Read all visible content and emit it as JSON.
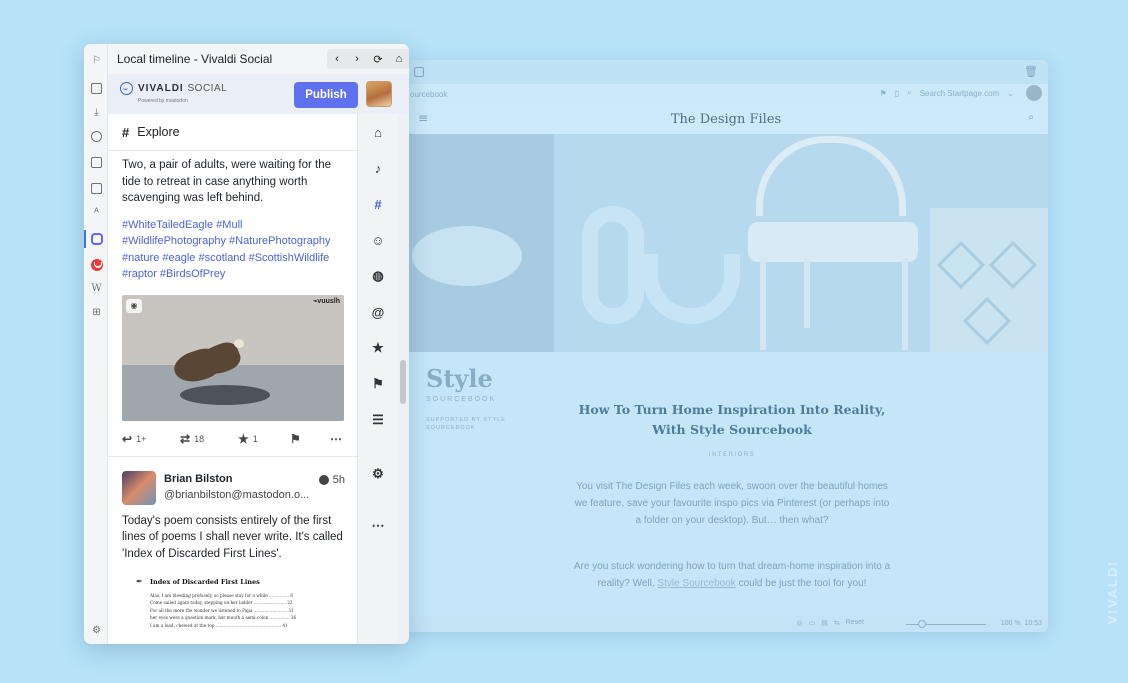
{
  "browser": {
    "panel_title": "Local timeline - Vivaldi Social",
    "nav": {
      "back": "‹",
      "forward": "›",
      "reload": "⟳",
      "home": "⌂",
      "close": "×"
    }
  },
  "mastodon": {
    "brand": "VIVALDI",
    "brand_suffix": "SOCIAL",
    "powered_by": "Powered by mastodon",
    "publish_label": "Publish",
    "column_title": "Explore",
    "post1": {
      "text": "Two, a pair of adults, were waiting for the tide to retreat in case anything worth scavenging was left behind.",
      "hashtags": "#WhiteTailedEagle #Mull #WildlifePhotography #NaturePhotography #nature #eagle #scotland #ScottishWildlife #raptor #BirdsOfPrey",
      "image_watermark": "⌁vuuslh",
      "reply_count": "1+",
      "boost_count": "18",
      "fav_count": "1"
    },
    "post2": {
      "author_name": "Brian Bilston",
      "author_handle": "@brianbilston@mastodon.o...",
      "time": "5h",
      "text": "Today's poem consists entirely of the first lines of poems I shall never write. It's called 'Index of Discarded First Lines'.",
      "poem_title": "Index of Discarded First Lines",
      "poem_lines": [
        "Alas, I am bleeding profusely, so please stay for a while ............... 6",
        "Come sailed again today, stepping on her ladder ........................ 22",
        "For all the more the wonder we listened to Papa ......................... 31",
        "her eyes were a question mark, her mouth a semi-colon ............... 36",
        "I am a lead, chewed at the top ................................................. 41"
      ]
    }
  },
  "background_page": {
    "address": "ourcebook",
    "search_placeholder": "Search Startpage.com",
    "site_title": "The Design Files",
    "logo_word": "Style",
    "logo_sub": "SOURCEBOOK",
    "logo_supported": "SUPPORTED BY STYLE SOURCEBOOK",
    "article_title": "How To Turn Home Inspiration Into Reality, With Style Sourcebook",
    "category": "INTERIORS",
    "para1": "You visit The Design Files each week, swoon over the beautiful homes we feature, save your favourite inspo pics via Pinterest (or perhaps into a folder on your desktop). But… then what?",
    "para2_start": "Are you stuck wondering how to turn that dream-home inspiration into a reality? Well, ",
    "para2_link": "Style Sourcebook",
    "para2_end": " could be just the tool for you!",
    "status_reset": "Reset",
    "status_zoom": "100 %",
    "status_time": "10:53"
  },
  "watermark": "VIVALDI"
}
